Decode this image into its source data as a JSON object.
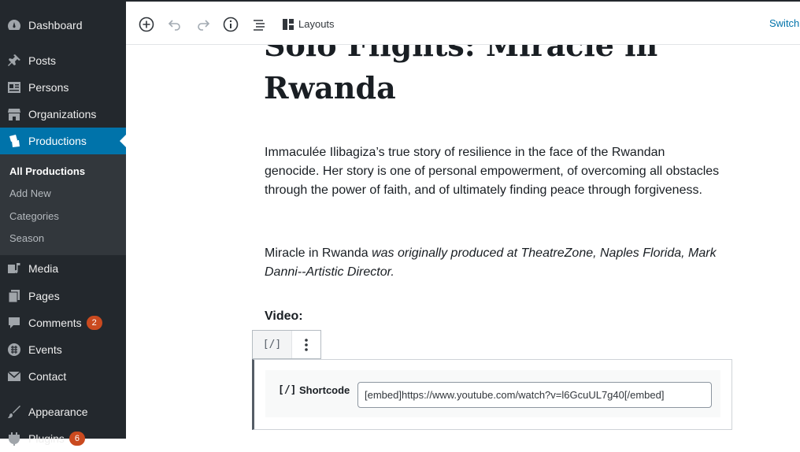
{
  "sidebar": {
    "items": [
      {
        "label": "Dashboard",
        "icon": "dashboard-icon"
      },
      {
        "label": "Posts",
        "icon": "pin-icon"
      },
      {
        "label": "Persons",
        "icon": "id-card-icon"
      },
      {
        "label": "Organizations",
        "icon": "store-icon"
      },
      {
        "label": "Productions",
        "icon": "tickets-icon"
      },
      {
        "label": "Media",
        "icon": "media-icon"
      },
      {
        "label": "Pages",
        "icon": "page-icon"
      },
      {
        "label": "Comments",
        "icon": "comment-icon",
        "badge": "2"
      },
      {
        "label": "Events",
        "icon": "calendar-icon"
      },
      {
        "label": "Contact",
        "icon": "email-icon"
      },
      {
        "label": "Appearance",
        "icon": "brush-icon"
      },
      {
        "label": "Plugins",
        "icon": "plugin-icon",
        "badge": "6"
      }
    ],
    "submenu": [
      "All Productions",
      "Add New",
      "Categories",
      "Season"
    ]
  },
  "toolbar": {
    "layouts_label": "Layouts",
    "switch_label": "Switch"
  },
  "post": {
    "title": "Solo Flights: Miracle in Rwanda",
    "para1": "Immaculée Ilibagiza’s true story of resilience in the face of the Rwandan genocide. Her story is one of personal empowerment, of overcoming all obstacles through the power of faith, and of ultimately finding peace through forgiveness.",
    "para2_plain": "Miracle in Rwanda ",
    "para2_italic": "was originally produced at TheatreZone, Naples Florida, Mark Danni--Artistic Director.",
    "video_heading": "Video:"
  },
  "block": {
    "switcher_glyph": "[/]",
    "shortcode_icon": "[/]",
    "shortcode_label": "Shortcode",
    "shortcode_value": "[embed]https://www.youtube.com/watch?v=l6GcuUL7g40[/embed]"
  },
  "colors": {
    "sidebar_bg": "#23282d",
    "active_bg": "#0073aa",
    "badge": "#ca4a1f",
    "link": "#0073aa"
  }
}
